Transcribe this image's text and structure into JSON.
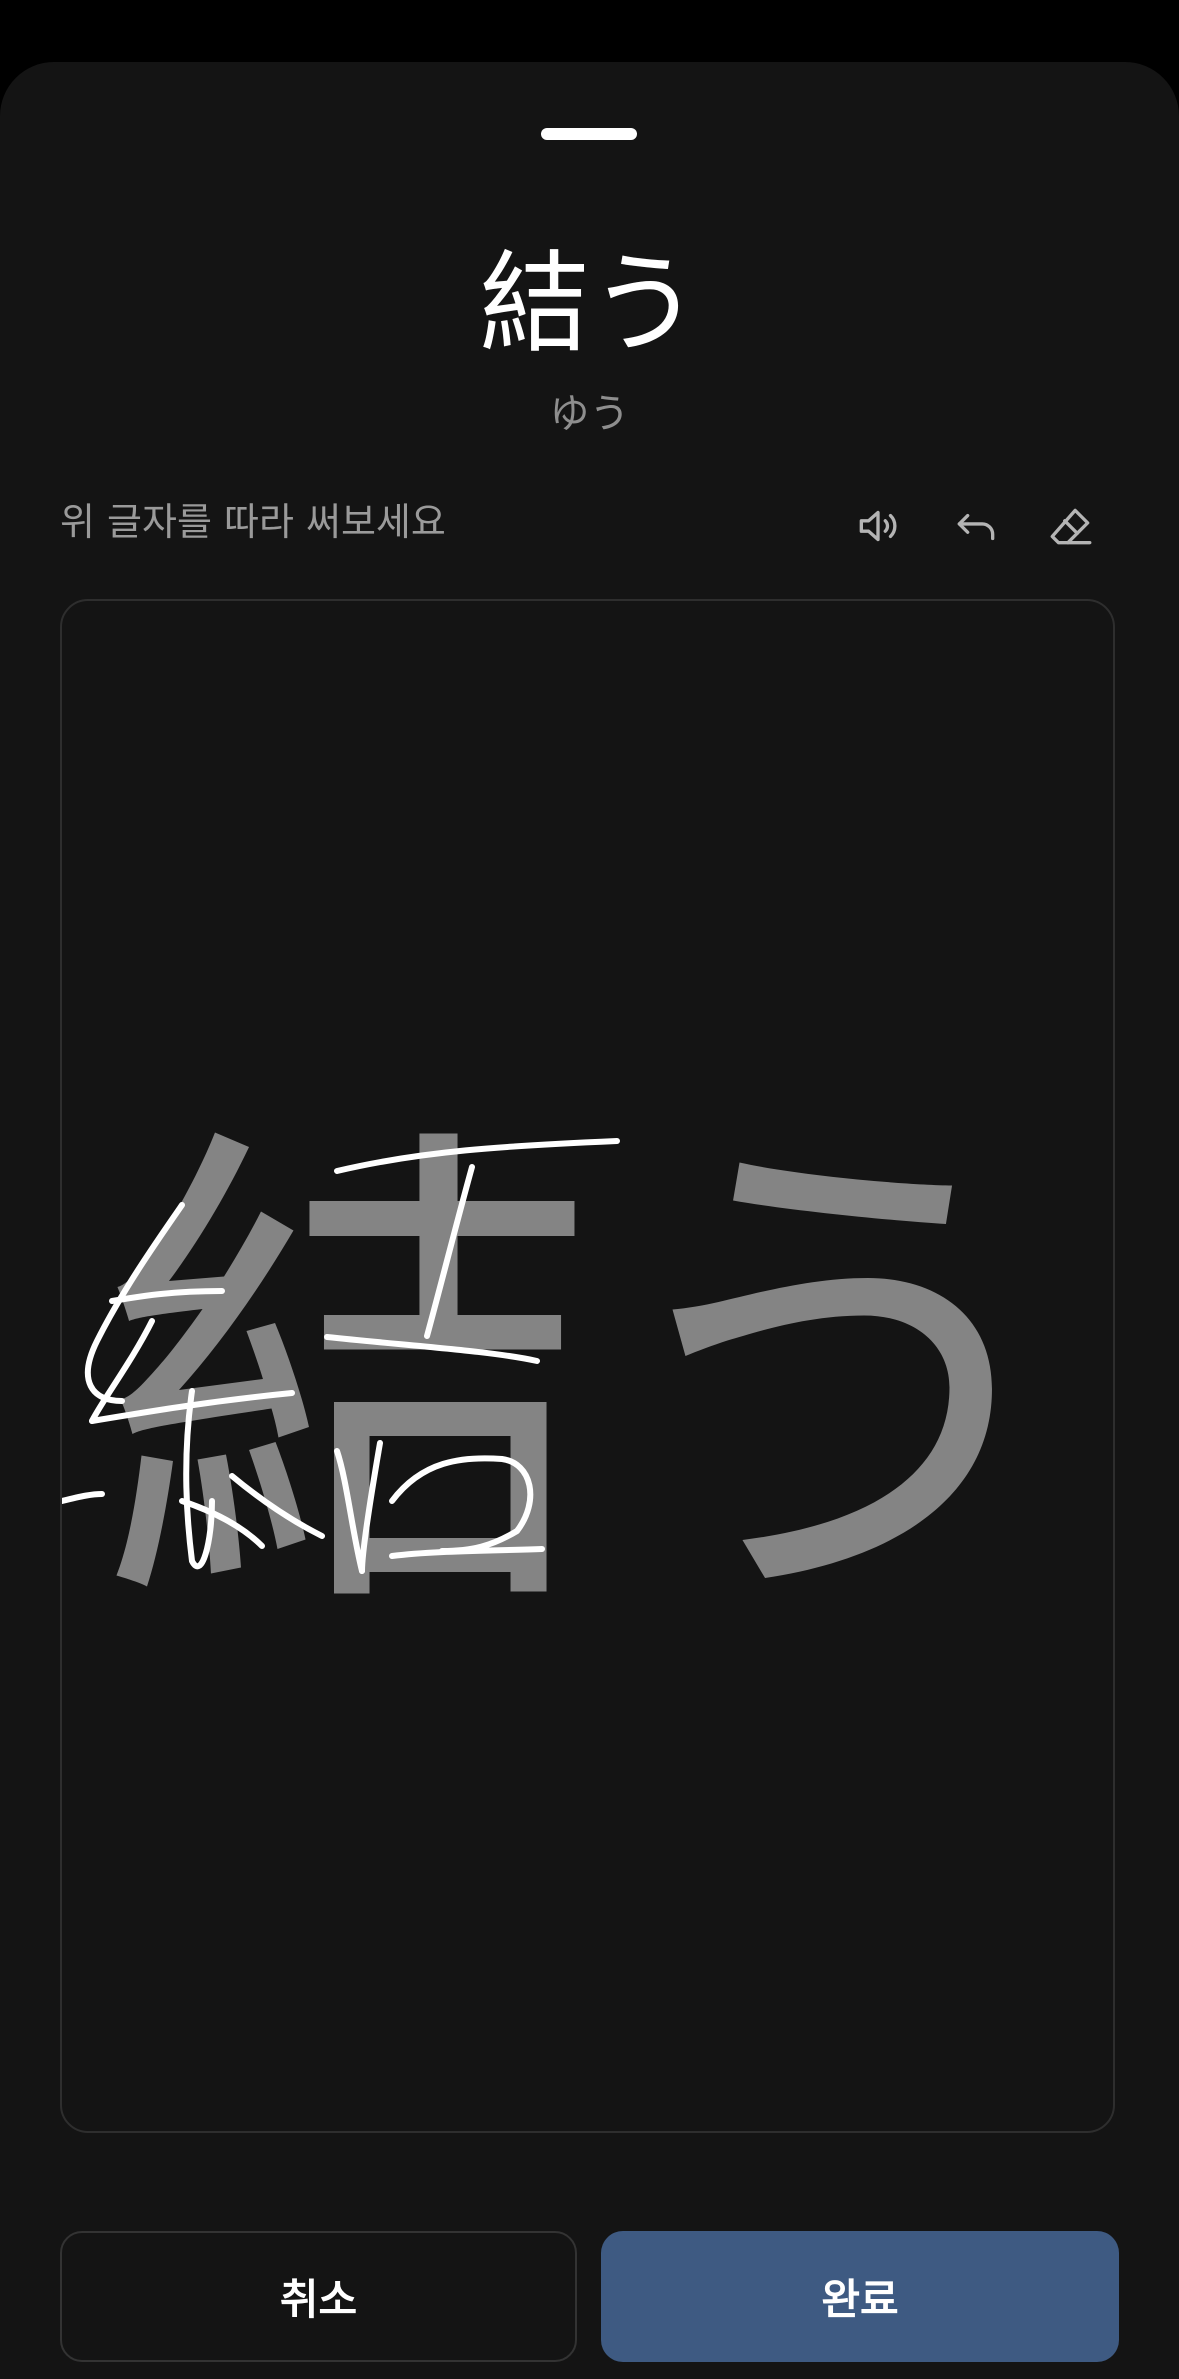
{
  "card": {
    "word": "結う",
    "reading": "ゆう",
    "instruction": "위 글자를 따라 써보세요"
  },
  "toolbar": {
    "icons": [
      "speaker-icon",
      "undo-icon",
      "eraser-icon"
    ]
  },
  "canvas": {
    "guide_text": "結う"
  },
  "buttons": {
    "cancel_label": "취소",
    "done_label": "완료"
  },
  "colors": {
    "background": "#141414",
    "accent": "#3e5a82",
    "guide": "#848484",
    "stroke": "#ffffff"
  }
}
